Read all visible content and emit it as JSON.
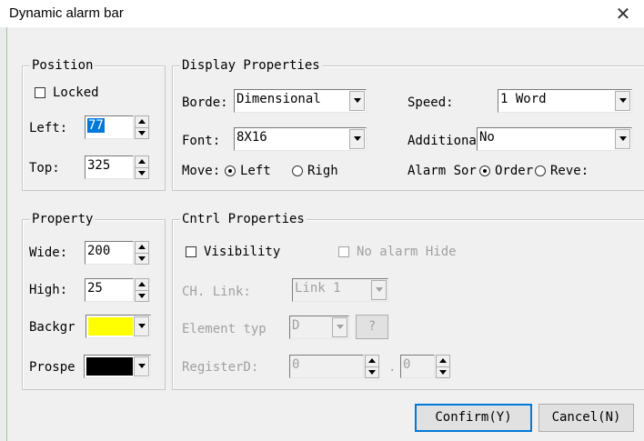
{
  "window": {
    "title": "Dynamic alarm bar",
    "close_glyph": "✕"
  },
  "position": {
    "group_label": "Position",
    "locked_label": "Locked",
    "left_label": "Left:",
    "left_value": "77",
    "top_label": "Top:",
    "top_value": "325"
  },
  "display": {
    "group_label": "Display Properties",
    "border_label": "Borde:",
    "border_value": "Dimensional",
    "font_label": "Font:",
    "font_value": "8X16",
    "move_label": "Move:",
    "move_left": "Left",
    "move_right": "Righ",
    "speed_label": "Speed:",
    "speed_value": "1 Word",
    "additional_label": "Additiona",
    "additional_value": "No",
    "alarm_sort_label": "Alarm Sor",
    "sort_order": "Order",
    "sort_reverse": "Reve:"
  },
  "property": {
    "group_label": "Property",
    "wide_label": "Wide:",
    "wide_value": "200",
    "high_label": "High:",
    "high_value": "25",
    "background_label": "Backgr",
    "background_color": "#ffff00",
    "prospect_label": "Prospe",
    "prospect_color": "#000000"
  },
  "cntrl": {
    "group_label": "Cntrl Properties",
    "visibility_label": "Visibility",
    "no_alarm_hide_label": "No alarm Hide",
    "ch_link_label": "CH. Link:",
    "ch_link_value": "Link 1",
    "element_type_label": "Element typ",
    "element_type_value": "D",
    "question_button": "?",
    "register_label": "RegisterD:",
    "register_value": "0",
    "register_sep": ".",
    "register_sub_value": "0"
  },
  "buttons": {
    "confirm": "Confirm(Y)",
    "cancel": "Cancel(N)"
  }
}
